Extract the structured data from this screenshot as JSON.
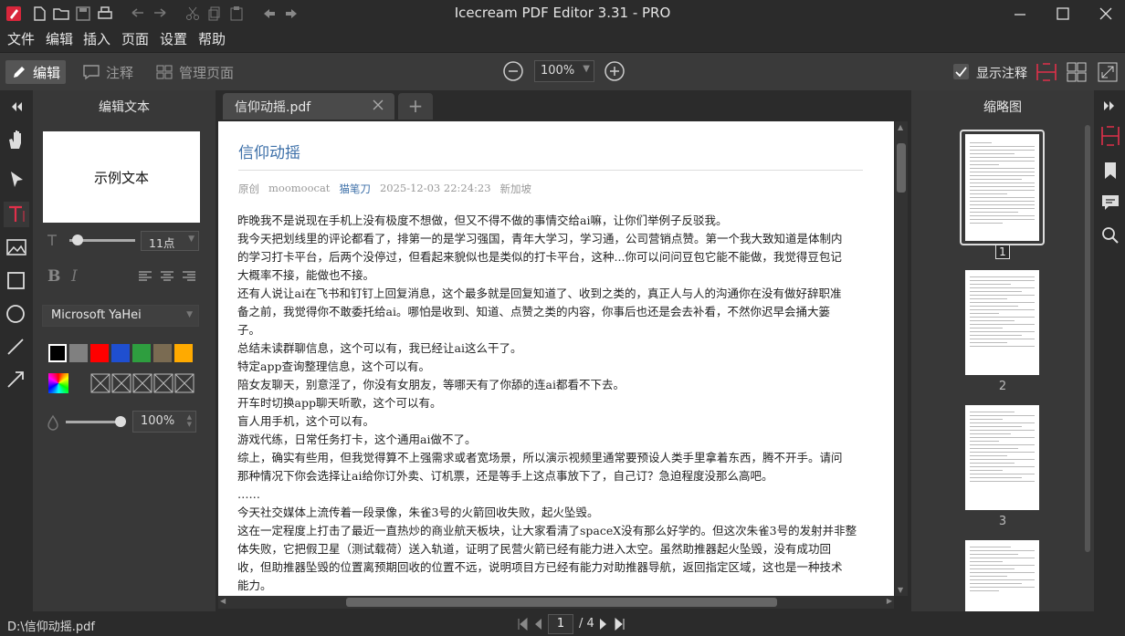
{
  "app": {
    "title": "Icecream PDF Editor 3.31 - PRO"
  },
  "menu": [
    "文件",
    "编辑",
    "插入",
    "页面",
    "设置",
    "帮助"
  ],
  "toolbar": {
    "modes": [
      "编辑",
      "注释",
      "管理页面"
    ],
    "zoom": "100%",
    "show_annotations": "显示注释"
  },
  "left_panel": {
    "title": "编辑文本",
    "sample_text": "示例文本",
    "font_size": "11点",
    "font_name": "Microsoft YaHei",
    "opacity": "100%",
    "colors": [
      "#000000",
      "#808080",
      "#ff0000",
      "#1f4fd0",
      "#2e9e3f",
      "#7a6b52",
      "#ffaa00"
    ]
  },
  "tabs": {
    "doc_tab": "信仰动摇.pdf",
    "add": "+"
  },
  "document": {
    "title": "信仰动摇",
    "meta": [
      "原创",
      "moomoocat",
      "猫笔刀",
      "2025-12-03 22:24:23",
      "新加坡"
    ],
    "lines": [
      "昨晚我不是说现在手机上没有极度不想做，但又不得不做的事情交给ai嘛，让你们举例子反驳我。",
      "我今天把划线里的评论都看了，排第一的是学习强国，青年大学习，学习通，公司营销点赞。第一个我大致知道是体制内",
      "的学习打卡平台，后两个没停过，但看起来貌似也是类似的打卡平台，这种...你可以问问豆包它能不能做，我觉得豆包记",
      "大概率不接，能做也不接。",
      "还有人说让ai在飞书和钉钉上回复消息，这个最多就是回复知道了、收到之类的，真正人与人的沟通你在没有做好辞职准",
      "备之前，我觉得你不敢委托给ai。哪怕是收到、知道、点赞之类的内容，你事后也还是会去补看，不然你迟早会捅大篓",
      "子。",
      "总结未读群聊信息，这个可以有，我已经让ai这么干了。",
      "特定app查询整理信息，这个可以有。",
      "陪女友聊天，别意淫了，你没有女朋友，等哪天有了你舔的连ai都看不下去。",
      "开车时切换app聊天听歌，这个可以有。",
      "盲人用手机，这个可以有。",
      "游戏代练，日常任务打卡，这个通用ai做不了。",
      "综上，确实有些用，但我觉得算不上强需求或者宽场景，所以演示视频里通常要预设人类手里拿着东西，腾不开手。请问",
      "那种情况下你会选择让ai给你订外卖、订机票，还是等手上这点事放下了，自己订？急迫程度没那么高吧。",
      "……",
      "今天社交媒体上流传着一段录像，朱雀3号的火箭回收失败，起火坠毁。",
      "这在一定程度上打击了最近一直热炒的商业航天板块，让大家看清了spaceX没有那么好学的。但这次朱雀3号的发射并非整",
      "体失败，它把假卫星（测试载荷）送入轨道，证明了民营火箭已经有能力进入太空。虽然助推器起火坠毁，没有成功回",
      "收，但助推器坠毁的位置离预期回收的位置不远，说明项目方已经有能力对助推器导航，返回指定区域，这也是一种技术",
      "能力。"
    ]
  },
  "thumbnails": {
    "title": "缩略图",
    "pages": [
      "1",
      "2",
      "3"
    ]
  },
  "status": {
    "path": "D:\\信仰动摇.pdf",
    "page": "1",
    "of": "/ 4"
  }
}
